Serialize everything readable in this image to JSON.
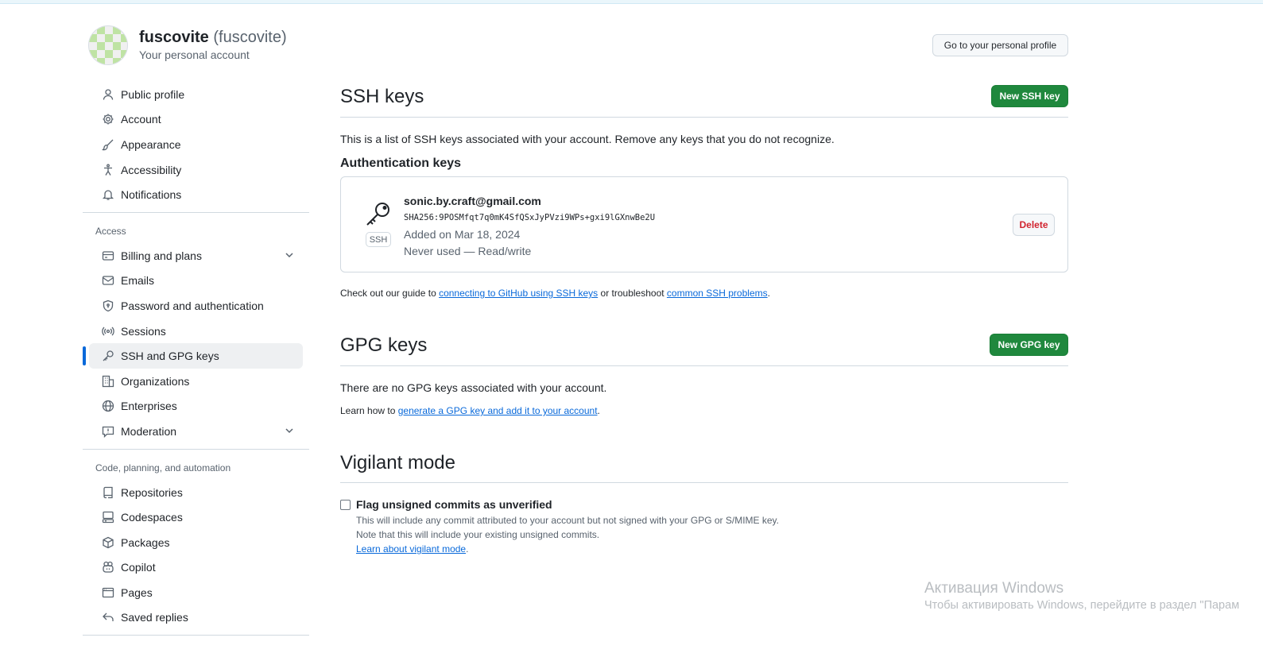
{
  "account": {
    "name": "fuscovite",
    "login": "(fuscovite)",
    "subtitle": "Your personal account",
    "profile_button": "Go to your personal profile"
  },
  "sidebar": {
    "group1": [
      {
        "label": "Public profile",
        "icon": "person-icon"
      },
      {
        "label": "Account",
        "icon": "gear-icon"
      },
      {
        "label": "Appearance",
        "icon": "paintbrush-icon"
      },
      {
        "label": "Accessibility",
        "icon": "accessibility-icon"
      },
      {
        "label": "Notifications",
        "icon": "bell-icon"
      }
    ],
    "access_heading": "Access",
    "group2": [
      {
        "label": "Billing and plans",
        "icon": "credit-card-icon"
      },
      {
        "label": "Emails",
        "icon": "mail-icon"
      },
      {
        "label": "Password and authentication",
        "icon": "shield-lock-icon"
      },
      {
        "label": "Sessions",
        "icon": "broadcast-icon"
      },
      {
        "label": "SSH and GPG keys",
        "icon": "key-icon"
      },
      {
        "label": "Organizations",
        "icon": "organization-icon"
      },
      {
        "label": "Enterprises",
        "icon": "globe-icon"
      },
      {
        "label": "Moderation",
        "icon": "report-icon"
      }
    ],
    "code_heading": "Code, planning, and automation",
    "group3": [
      {
        "label": "Repositories",
        "icon": "repo-icon"
      },
      {
        "label": "Codespaces",
        "icon": "codespaces-icon"
      },
      {
        "label": "Packages",
        "icon": "package-icon"
      },
      {
        "label": "Copilot",
        "icon": "copilot-icon"
      },
      {
        "label": "Pages",
        "icon": "browser-icon"
      },
      {
        "label": "Saved replies",
        "icon": "reply-icon"
      }
    ]
  },
  "ssh": {
    "title": "SSH keys",
    "new_button": "New SSH key",
    "description": "This is a list of SSH keys associated with your account. Remove any keys that you do not recognize.",
    "auth_heading": "Authentication keys",
    "key": {
      "title": "sonic.by.craft@gmail.com",
      "fingerprint": "SHA256:9POSMfqt7q0mK4SfQSxJyPVzi9WPs+gxi9lGXnwBe2U",
      "added": "Added on Mar 18, 2024",
      "usage": "Never used — Read/write",
      "badge": "SSH",
      "delete_button": "Delete"
    },
    "guide_pre": "Check out our guide to ",
    "guide_link": "connecting to GitHub using SSH keys",
    "guide_mid": " or troubleshoot ",
    "guide_link2": "common SSH problems",
    "guide_post": "."
  },
  "gpg": {
    "title": "GPG keys",
    "new_button": "New GPG key",
    "empty": "There are no GPG keys associated with your account.",
    "learn_pre": "Learn how to ",
    "learn_link": "generate a GPG key and add it to your account",
    "learn_post": "."
  },
  "vigilant": {
    "title": "Vigilant mode",
    "checkbox_label": "Flag unsigned commits as unverified",
    "note1": "This will include any commit attributed to your account but not signed with your GPG or S/MIME key.",
    "note2": "Note that this will include your existing unsigned commits.",
    "learn_link": "Learn about vigilant mode",
    "learn_post": "."
  },
  "watermark": {
    "line1": "Активация Windows",
    "line2": "Чтобы активировать Windows, перейдите в раздел \"Парам"
  }
}
